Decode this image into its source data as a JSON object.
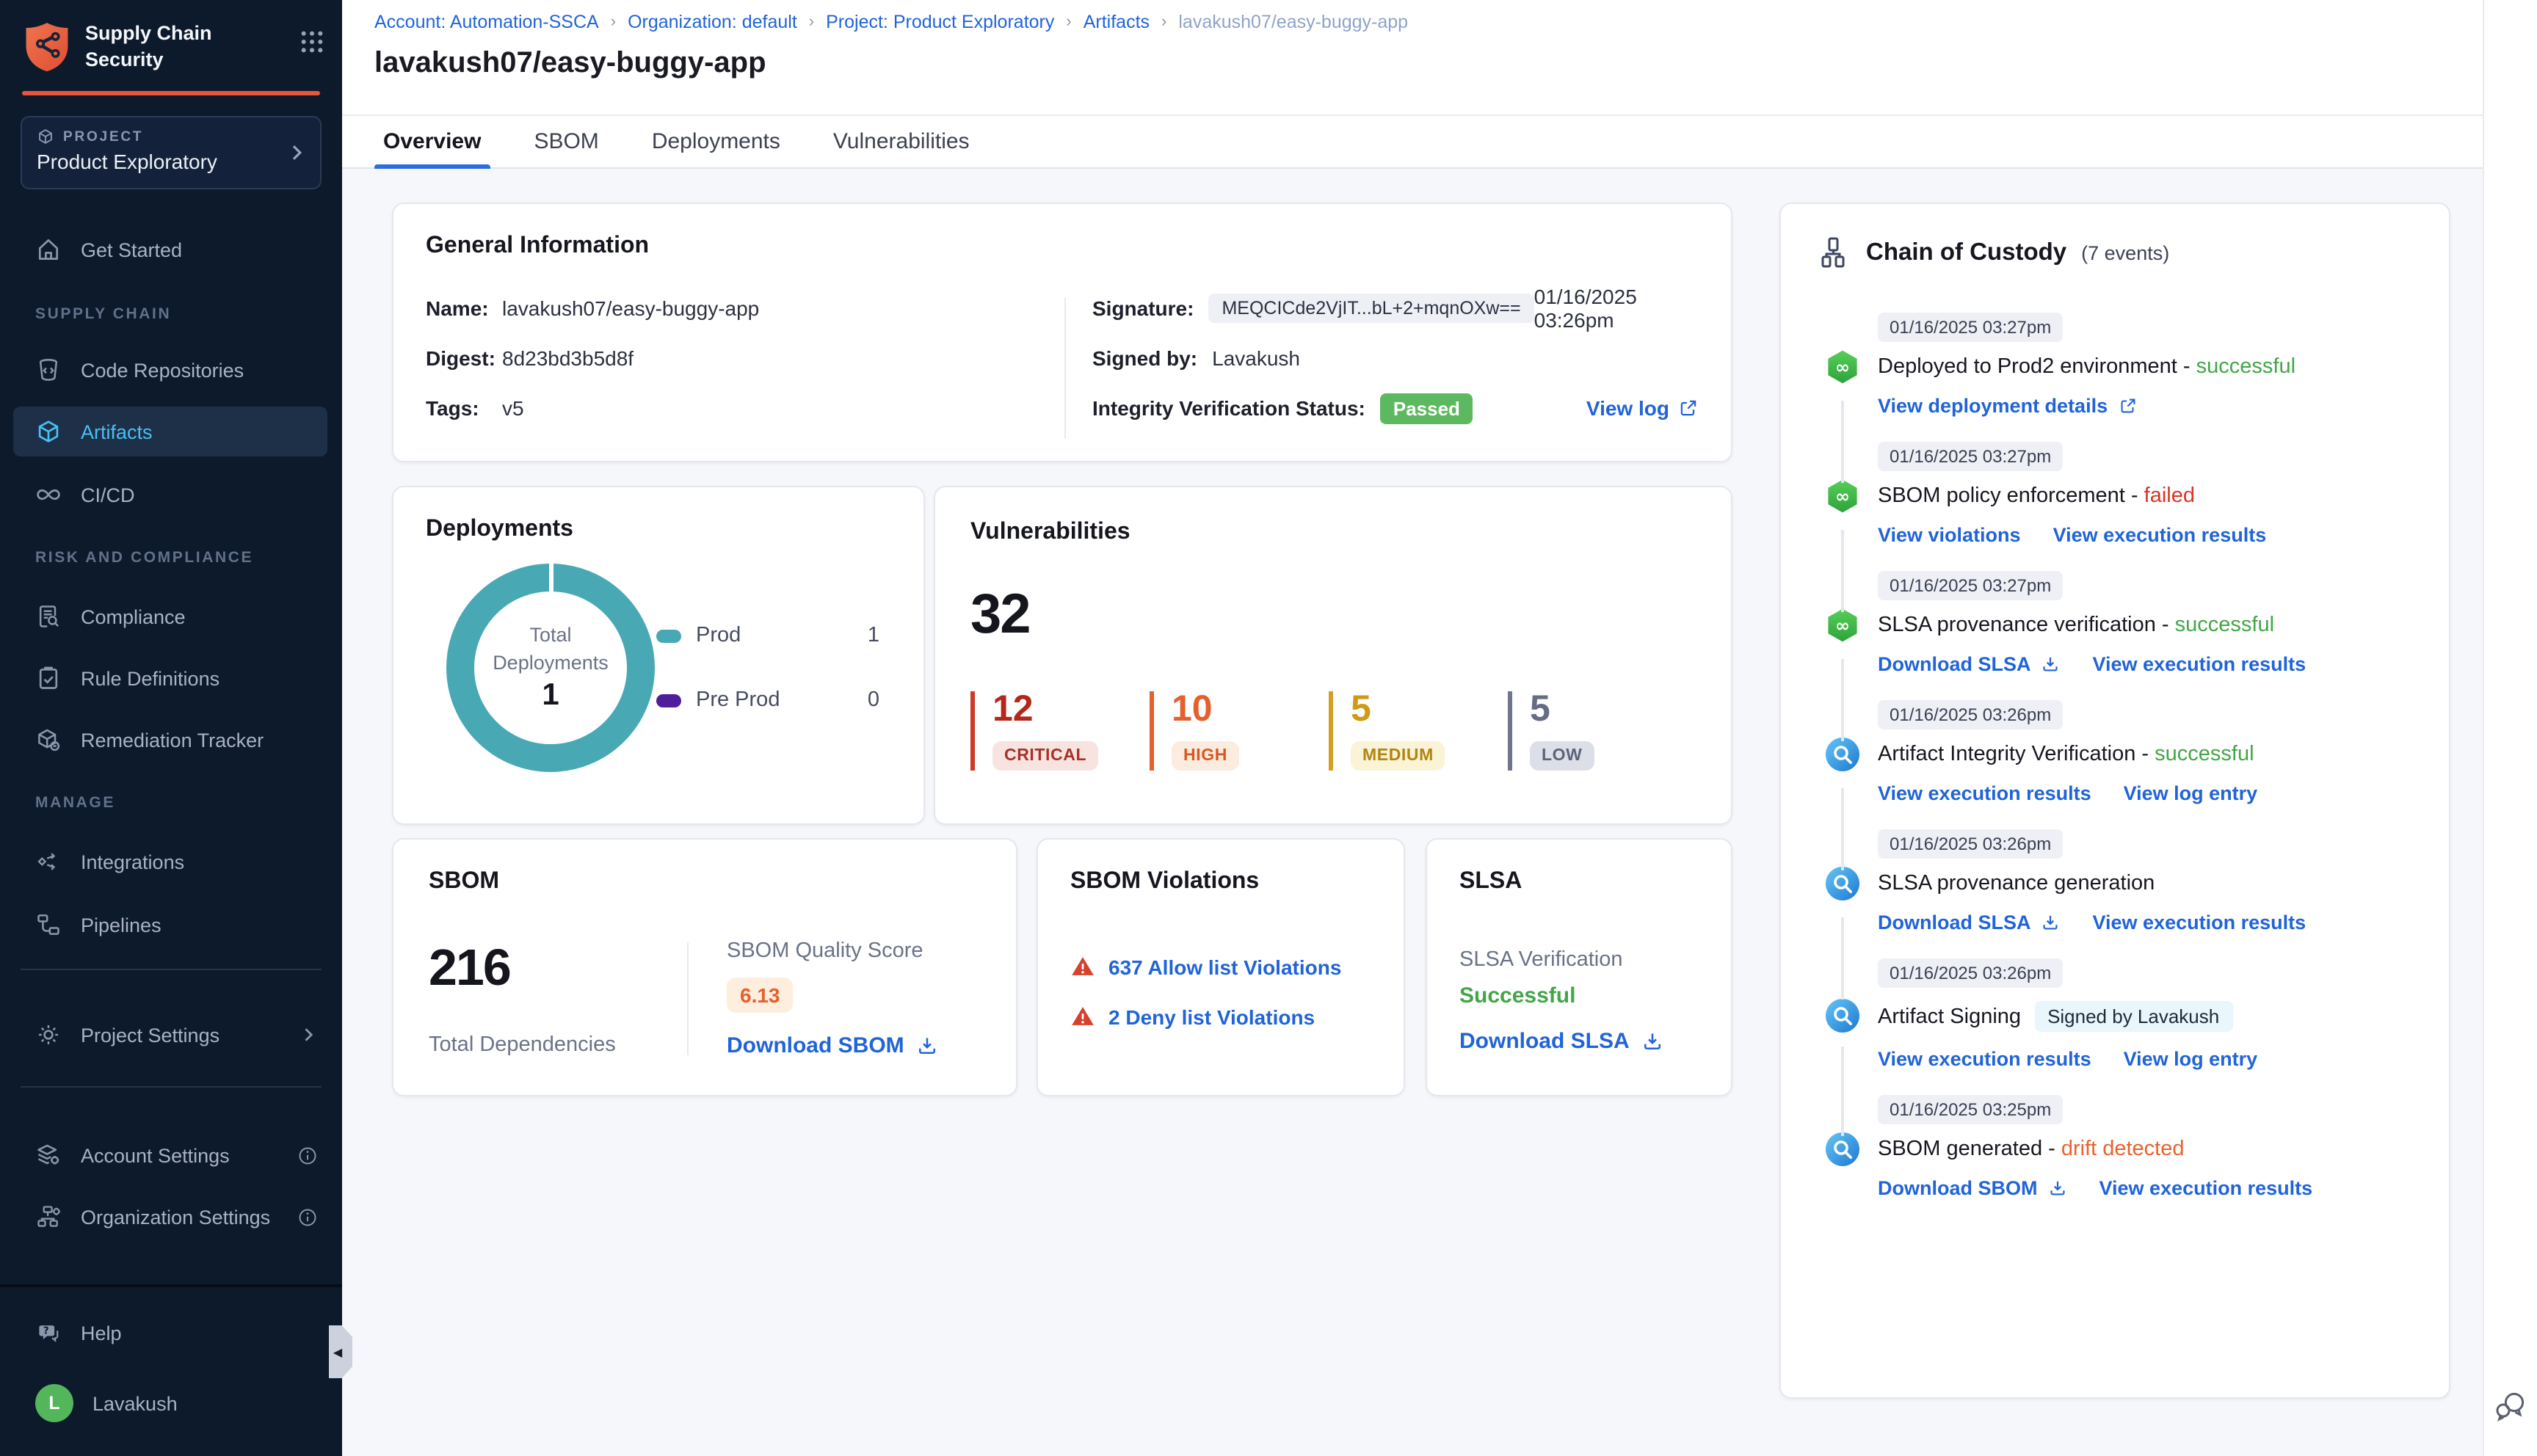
{
  "app": {
    "title": "Supply Chain Security"
  },
  "sidebar": {
    "project": {
      "label": "PROJECT",
      "name": "Product Exploratory"
    },
    "items": {
      "get_started": "Get Started",
      "supply_chain_section": "SUPPLY CHAIN",
      "code_repositories": "Code Repositories",
      "artifacts": "Artifacts",
      "cicd": "CI/CD",
      "risk_section": "RISK AND COMPLIANCE",
      "compliance": "Compliance",
      "rule_definitions": "Rule Definitions",
      "remediation_tracker": "Remediation Tracker",
      "manage_section": "MANAGE",
      "integrations": "Integrations",
      "pipelines": "Pipelines",
      "project_settings": "Project Settings",
      "account_settings": "Account Settings",
      "organization_settings": "Organization Settings",
      "help": "Help",
      "user": "Lavakush",
      "user_initial": "L"
    }
  },
  "breadcrumb": {
    "separator": "›",
    "items": [
      "Account: Automation-SSCA",
      "Organization: default",
      "Project: Product Exploratory",
      "Artifacts",
      "lavakush07/easy-buggy-app"
    ]
  },
  "page": {
    "title": "lavakush07/easy-buggy-app",
    "tabs": [
      "Overview",
      "SBOM",
      "Deployments",
      "Vulnerabilities"
    ]
  },
  "general_info": {
    "title": "General Information",
    "name_label": "Name:",
    "name_value": "lavakush07/easy-buggy-app",
    "digest_label": "Digest:",
    "digest_value": "8d23bd3b5d8f",
    "tags_label": "Tags:",
    "tags_value": "v5",
    "signature_label": "Signature:",
    "signature_value": "MEQCICde2VjIT...bL+2+mqnOXw==",
    "signature_time": "01/16/2025 03:26pm",
    "signed_by_label": "Signed by:",
    "signed_by_value": "Lavakush",
    "integrity_label": "Integrity Verification Status:",
    "integrity_status": "Passed",
    "view_log": "View log"
  },
  "deployments": {
    "title": "Deployments",
    "center_label_line1": "Total",
    "center_label_line2": "Deployments",
    "center_value": "1",
    "legend": [
      {
        "label": "Prod",
        "value": "1",
        "color": "#48a9b5"
      },
      {
        "label": "Pre Prod",
        "value": "0",
        "color": "#4e1e9d"
      }
    ],
    "chart_data": {
      "type": "pie",
      "categories": [
        "Prod",
        "Pre Prod"
      ],
      "values": [
        1,
        0
      ],
      "title": "Total Deployments",
      "total": 1,
      "legend_position": "right"
    }
  },
  "vulnerabilities": {
    "title": "Vulnerabilities",
    "total": "32",
    "severities": [
      {
        "label": "CRITICAL",
        "value": "12",
        "color": "#b4271b"
      },
      {
        "label": "HIGH",
        "value": "10",
        "color": "#e4602c"
      },
      {
        "label": "MEDIUM",
        "value": "5",
        "color": "#cf9a16"
      },
      {
        "label": "LOW",
        "value": "5",
        "color": "#666c83"
      }
    ]
  },
  "sbom": {
    "title": "SBOM",
    "total": "216",
    "total_label": "Total Dependencies",
    "score_label": "SBOM Quality Score",
    "score": "6.13",
    "download": "Download SBOM"
  },
  "sbom_violations": {
    "title": "SBOM Violations",
    "allow": "637 Allow list Violations",
    "deny": "2 Deny list Violations"
  },
  "slsa": {
    "title": "SLSA",
    "verification_label": "SLSA Verification",
    "verification_status": "Successful",
    "download": "Download SLSA"
  },
  "chain_of_custody": {
    "title": "Chain of Custody",
    "count": "(7 events)",
    "events": [
      {
        "time": "01/16/2025 03:27pm",
        "title": "Deployed to Prod2 environment - ",
        "status": "successful",
        "links": [
          "View deployment details"
        ]
      },
      {
        "time": "01/16/2025 03:27pm",
        "title": "SBOM policy enforcement - ",
        "status": "failed",
        "links": [
          "View violations",
          "View execution results"
        ]
      },
      {
        "time": "01/16/2025 03:27pm",
        "title": "SLSA provenance verification - ",
        "status": "successful",
        "links": [
          "Download SLSA",
          "View execution results"
        ]
      },
      {
        "time": "01/16/2025 03:26pm",
        "title": "Artifact Integrity Verification - ",
        "status": "successful",
        "links": [
          "View execution results",
          "View log entry"
        ]
      },
      {
        "time": "01/16/2025 03:26pm",
        "title": "SLSA provenance generation",
        "status": "",
        "links": [
          "Download SLSA",
          "View execution results"
        ]
      },
      {
        "time": "01/16/2025 03:26pm",
        "title": "Artifact Signing",
        "status": "",
        "badge": "Signed by Lavakush",
        "links": [
          "View execution results",
          "View log entry"
        ]
      },
      {
        "time": "01/16/2025 03:25pm",
        "title": "SBOM generated - ",
        "status": "drift detected",
        "links": [
          "Download SBOM",
          "View execution results"
        ]
      }
    ]
  },
  "icons": {
    "logo": "shield-graph-icon",
    "grid": "app-grid-icon",
    "download": "download-icon",
    "external": "external-link-icon",
    "warning": "warning-triangle-icon",
    "chat": "feedback-chat-icon"
  },
  "colors": {
    "accent_orange": "#e8563d",
    "sidebar_bg": "#0c1a2c",
    "selected_item": "#46c1f2",
    "link_blue": "#2064d8",
    "passed_green": "#5cb95f",
    "success_green": "#42a648",
    "failed_red": "#da3425",
    "drift_orange": "#e8622d",
    "prod_teal": "#48a9b5",
    "preprod_purple": "#4e1e9d"
  }
}
